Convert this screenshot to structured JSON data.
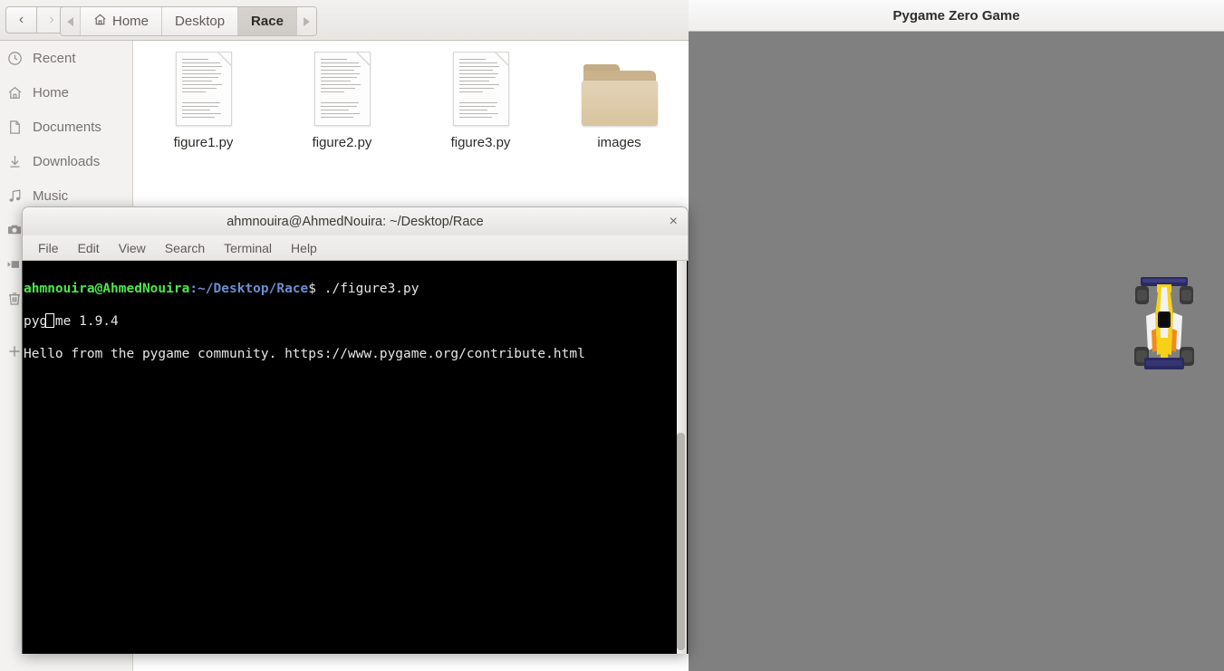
{
  "filemanager": {
    "nav": {
      "back_icon": "chevron-left-icon",
      "forward_icon": "chevron-right-icon"
    },
    "breadcrumb": {
      "scroll_left_icon": "triangle-left-icon",
      "scroll_right_icon": "triangle-right-icon",
      "home_icon": "home-icon",
      "items": [
        {
          "label": "Home",
          "active": false
        },
        {
          "label": "Desktop",
          "active": false
        },
        {
          "label": "Race",
          "active": true
        }
      ]
    },
    "sidebar": {
      "items": [
        {
          "label": "Recent",
          "icon": "clock-icon"
        },
        {
          "label": "Home",
          "icon": "home-icon"
        },
        {
          "label": "Documents",
          "icon": "document-icon"
        },
        {
          "label": "Downloads",
          "icon": "download-icon"
        },
        {
          "label": "Music",
          "icon": "music-note-icon"
        },
        {
          "label": "",
          "icon": "camera-icon"
        },
        {
          "label": "",
          "icon": "video-icon"
        },
        {
          "label": "",
          "icon": "trash-icon"
        },
        {
          "label": "",
          "icon": "plus-icon"
        }
      ]
    },
    "files": [
      {
        "name": "figure1.py",
        "type": "document"
      },
      {
        "name": "figure2.py",
        "type": "document"
      },
      {
        "name": "figure3.py",
        "type": "document"
      },
      {
        "name": "images",
        "type": "folder"
      }
    ]
  },
  "terminal": {
    "title": "ahmnouira@AhmedNouira: ~/Desktop/Race",
    "close_label": "×",
    "menus": [
      "File",
      "Edit",
      "View",
      "Search",
      "Terminal",
      "Help"
    ],
    "prompt": {
      "user_host": "ahmnouira@AhmedNouira",
      "path": ":~/Desktop/Race",
      "command": "$ ./figure3.py"
    },
    "output_lines": [
      "pygame 1.9.4",
      "Hello from the pygame community. https://www.pygame.org/contribute.html"
    ],
    "colors": {
      "user_host": "#4ee64e",
      "path": "#6a8fd0",
      "text": "#e6e6e6",
      "background": "#000000"
    }
  },
  "pygame_window": {
    "title": "Pygame Zero Game",
    "canvas_color": "#808080",
    "sprite": {
      "name": "race-car-sprite",
      "colors": {
        "wing": "#2a2a63",
        "tire": "#3a3a3a",
        "body_yellow": "#f7d117",
        "body_white": "#f2f2f2",
        "body_orange": "#f08a1e",
        "cockpit": "#161616"
      }
    }
  }
}
